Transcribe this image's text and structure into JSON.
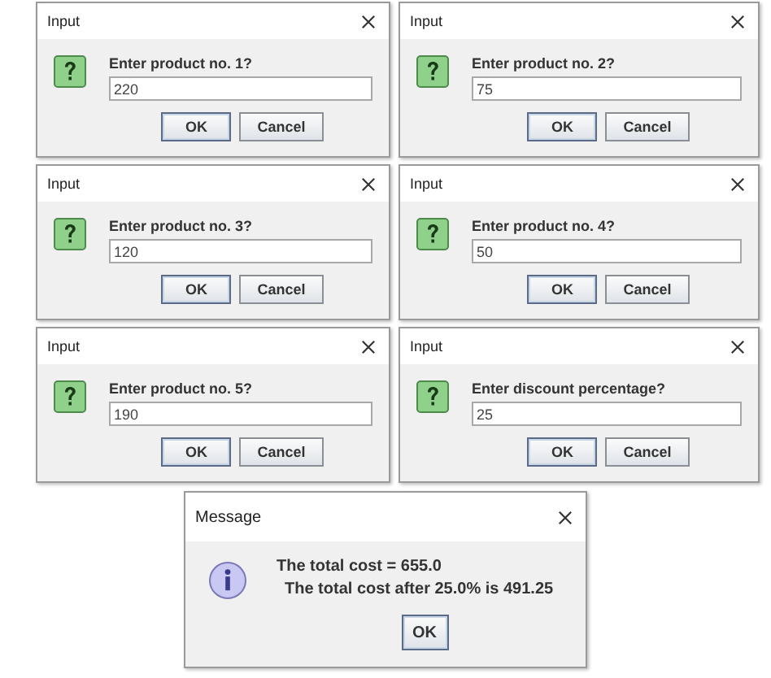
{
  "dialogs": [
    {
      "title": "Input",
      "prompt": "Enter product no. 1?",
      "value": "220",
      "buttons": [
        "OK",
        "Cancel"
      ]
    },
    {
      "title": "Input",
      "prompt": "Enter product no. 2?",
      "value": "75",
      "buttons": [
        "OK",
        "Cancel"
      ]
    },
    {
      "title": "Input",
      "prompt": "Enter product no. 3?",
      "value": "120",
      "buttons": [
        "OK",
        "Cancel"
      ]
    },
    {
      "title": "Input",
      "prompt": "Enter product no. 4?",
      "value": "50",
      "buttons": [
        "OK",
        "Cancel"
      ]
    },
    {
      "title": "Input",
      "prompt": "Enter product no. 5?",
      "value": "190",
      "buttons": [
        "OK",
        "Cancel"
      ]
    },
    {
      "title": "Input",
      "prompt": "Enter discount percentage?",
      "value": "25",
      "buttons": [
        "OK",
        "Cancel"
      ]
    }
  ],
  "message": {
    "title": "Message",
    "lines": [
      "The total cost = 655.0",
      "The total cost after 25.0% is 491.25"
    ],
    "buttons": [
      "OK"
    ]
  }
}
